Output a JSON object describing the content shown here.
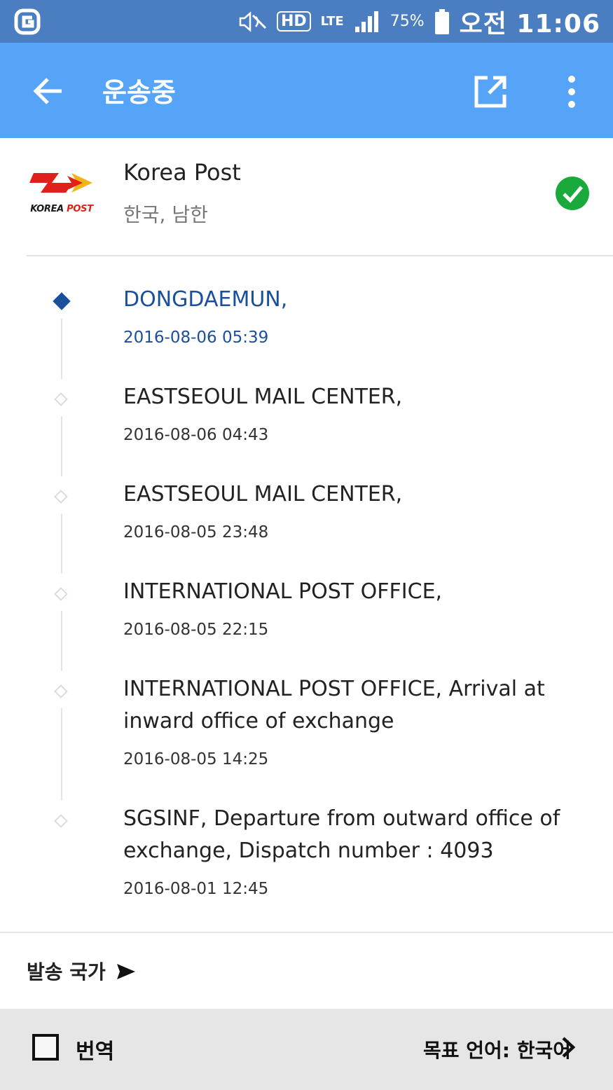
{
  "status_bar": {
    "carrier_icon": "g-logo-icon",
    "hd_label": "HD",
    "lte_label": "LTE",
    "battery": "75%",
    "ampm": "오전",
    "time": "11:06"
  },
  "app_bar": {
    "title": "운송중",
    "back_icon": "arrow-left-icon",
    "open_icon": "open-external-icon",
    "more_icon": "more-vert-icon",
    "color": "#55a4f7"
  },
  "carrier": {
    "logo_text_black": "KOREA",
    "logo_text_red": "POST",
    "name": "Korea Post",
    "country": "한국, 남한",
    "status_icon": "check-circle-icon",
    "status_color": "#1aaa3c"
  },
  "events": [
    {
      "location": "DONGDAEMUN,",
      "time": "2016-08-06 05:39",
      "active": true
    },
    {
      "location": "EASTSEOUL MAIL CENTER,",
      "time": "2016-08-06 04:43",
      "active": false
    },
    {
      "location": "EASTSEOUL MAIL CENTER,",
      "time": "2016-08-05 23:48",
      "active": false
    },
    {
      "location": "INTERNATIONAL POST OFFICE,",
      "time": "2016-08-05 22:15",
      "active": false
    },
    {
      "location": "INTERNATIONAL POST OFFICE, Arrival at inward office of exchange",
      "time": "2016-08-05 14:25",
      "active": false
    },
    {
      "location": "SGSINF, Departure from outward office of exchange, Dispatch number : 4093",
      "time": "2016-08-01 12:45",
      "active": false
    }
  ],
  "origin": {
    "label": "발송 국가",
    "icon": "send-arrow-icon"
  },
  "translate": {
    "checkbox_label": "번역",
    "checked": false,
    "target_language": "목표 언어: 한국어",
    "chevron_icon": "chevron-right-icon"
  }
}
